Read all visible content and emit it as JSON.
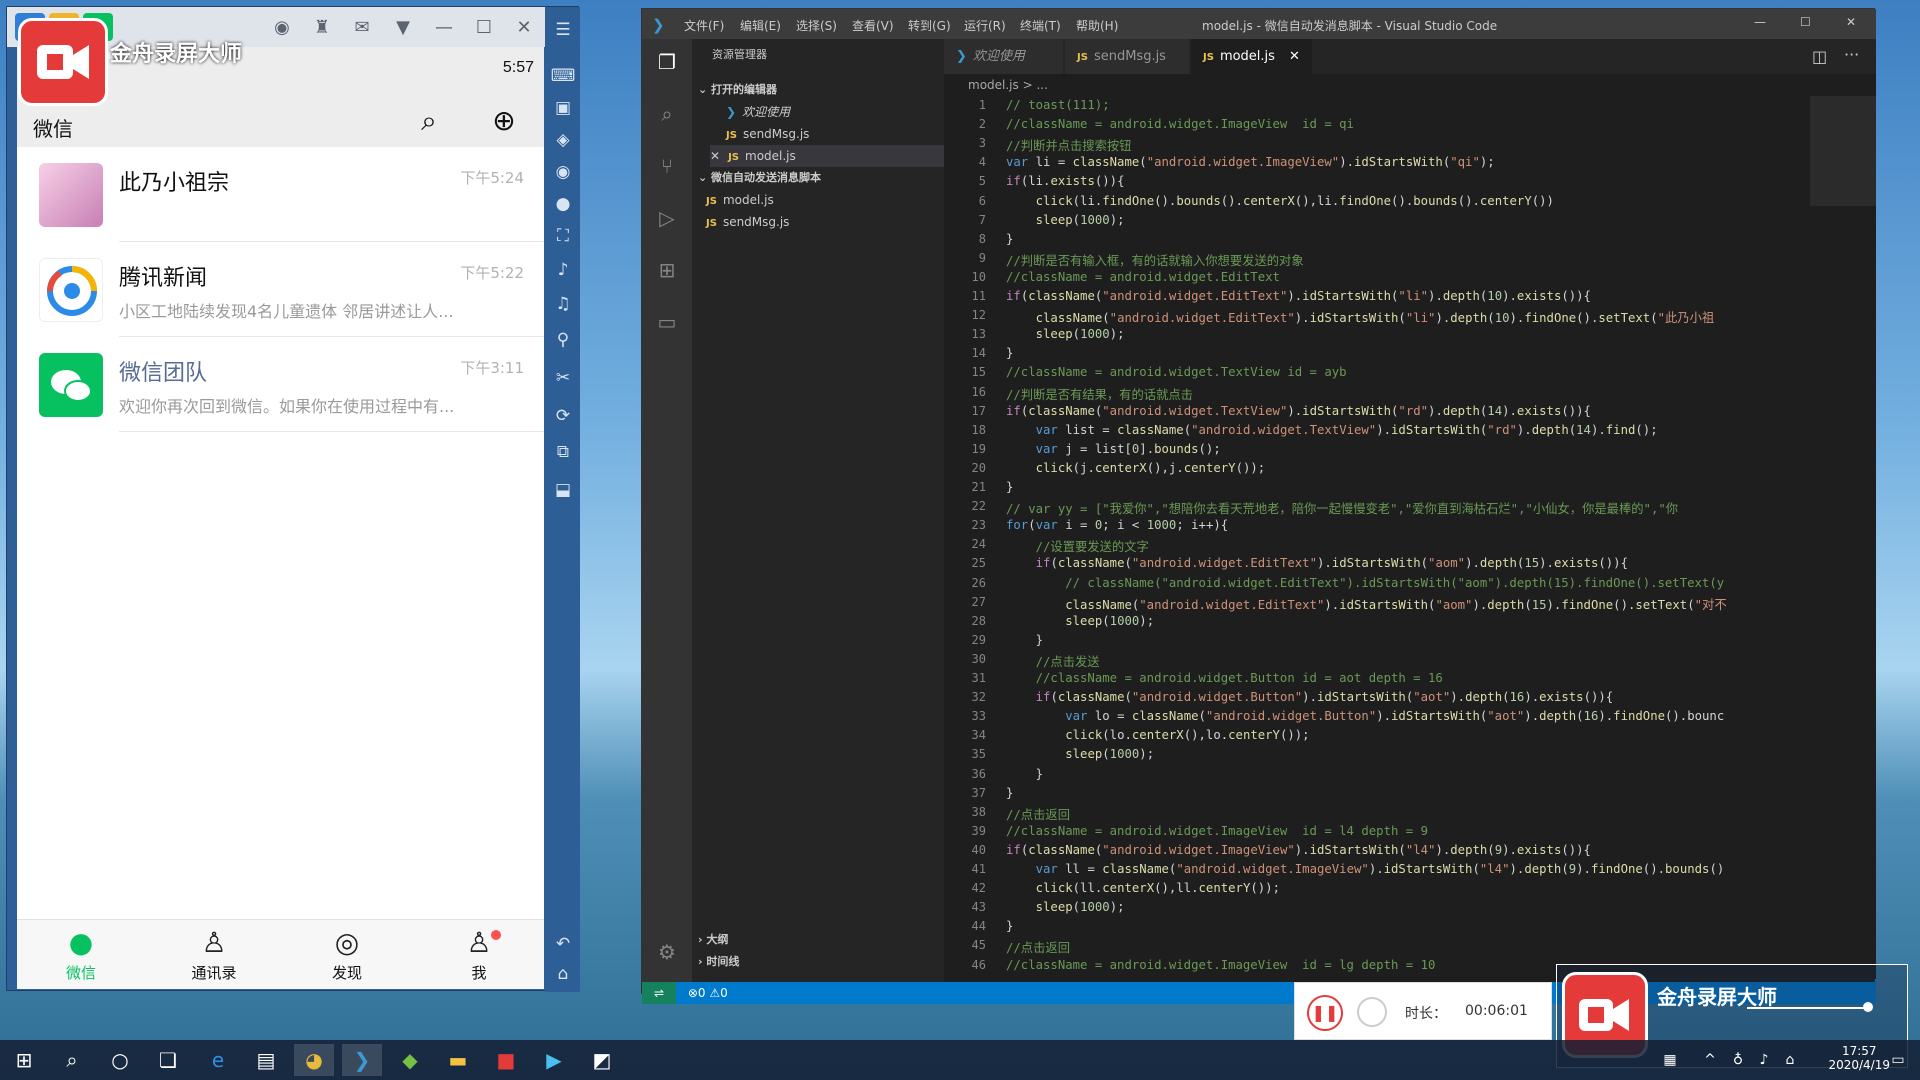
{
  "phone": {
    "recorder_brand": "金舟录屏大师",
    "status_time": "5:57",
    "header_title": "微信",
    "chats": [
      {
        "name": "此乃小祖宗",
        "time": "下午5:24",
        "preview": ""
      },
      {
        "name": "腾讯新闻",
        "time": "下午5:22",
        "preview": "小区工地陆续发现4名儿童遗体 邻居讲述让人..."
      },
      {
        "name": "微信团队",
        "time": "下午3:11",
        "preview": "欢迎你再次回到微信。如果你在使用过程中有..."
      }
    ],
    "tabs": [
      {
        "label": "微信"
      },
      {
        "label": "通讯录"
      },
      {
        "label": "发现"
      },
      {
        "label": "我"
      }
    ],
    "colors": {
      "wechat_green": "#07c160",
      "badge_red": "#fa5151"
    }
  },
  "vscode": {
    "menus": [
      "文件(F)",
      "编辑(E)",
      "选择(S)",
      "查看(V)",
      "转到(G)",
      "运行(R)",
      "终端(T)",
      "帮助(H)"
    ],
    "window_title": "model.js - 微信自动发消息脚本 - Visual Studio Code",
    "explorer": {
      "header": "资源管理器",
      "open_editors": "打开的编辑器",
      "open_files": [
        "欢迎使用",
        "sendMsg.js",
        "model.js"
      ],
      "folder": "微信自动发送消息脚本",
      "folder_files": [
        "model.js",
        "sendMsg.js"
      ],
      "outline": "大纲",
      "timeline": "时间线"
    },
    "tabs": [
      "欢迎使用",
      "sendMsg.js",
      "model.js"
    ],
    "breadcrumb": "model.js > ...",
    "status": {
      "errors": "0",
      "warnings": "0"
    },
    "code_lines": [
      "// toast(111);",
      "//className = android.widget.ImageView  id = qi",
      "//判断并点击搜索按钮",
      "var li = className(\"android.widget.ImageView\").idStartsWith(\"qi\");",
      "if(li.exists()){",
      "    click(li.findOne().bounds().centerX(),li.findOne().bounds().centerY())",
      "    sleep(1000);",
      "}",
      "//判断是否有输入框，有的话就输入你想要发送的对象",
      "//className = android.widget.EditText",
      "if(className(\"android.widget.EditText\").idStartsWith(\"li\").depth(10).exists()){",
      "    className(\"android.widget.EditText\").idStartsWith(\"li\").depth(10).findOne().setText(\"此乃小祖",
      "    sleep(1000);",
      "}",
      "//className = android.widget.TextView id = ayb",
      "//判断是否有结果，有的话就点击",
      "if(className(\"android.widget.TextView\").idStartsWith(\"rd\").depth(14).exists()){",
      "    var list = className(\"android.widget.TextView\").idStartsWith(\"rd\").depth(14).find();",
      "    var j = list[0].bounds();",
      "    click(j.centerX(),j.centerY());",
      "}",
      "// var yy = [\"我爱你\",\"想陪你去看天荒地老，陪你一起慢慢变老\",\"爱你直到海枯石烂\",\"小仙女，你是最棒的\",\"你",
      "for(var i = 0; i < 1000; i++){",
      "    //设置要发送的文字",
      "    if(className(\"android.widget.EditText\").idStartsWith(\"aom\").depth(15).exists()){",
      "        // className(\"android.widget.EditText\").idStartsWith(\"aom\").depth(15).findOne().setText(y",
      "        className(\"android.widget.EditText\").idStartsWith(\"aom\").depth(15).findOne().setText(\"对不",
      "        sleep(1000);",
      "    }",
      "    //点击发送",
      "    //className = android.widget.Button id = aot depth = 16",
      "    if(className(\"android.widget.Button\").idStartsWith(\"aot\").depth(16).exists()){",
      "        var lo = className(\"android.widget.Button\").idStartsWith(\"aot\").depth(16).findOne().bounc",
      "        click(lo.centerX(),lo.centerY());",
      "        sleep(1000);",
      "    }",
      "}",
      "//点击返回",
      "//className = android.widget.ImageView  id = l4 depth = 9",
      "if(className(\"android.widget.ImageView\").idStartsWith(\"l4\").depth(9).exists()){",
      "    var ll = className(\"android.widget.ImageView\").idStartsWith(\"l4\").depth(9).findOne().bounds()",
      "    click(ll.centerX(),ll.centerY());",
      "    sleep(1000);",
      "}",
      "//点击返回",
      "//className = android.widget.ImageView  id = lg depth = 10"
    ]
  },
  "recorder": {
    "duration_label": "时长：",
    "duration": "00:06:01",
    "brand": "金舟录屏大师"
  },
  "taskbar": {
    "time": "17:57",
    "date": "2020/4/19"
  }
}
